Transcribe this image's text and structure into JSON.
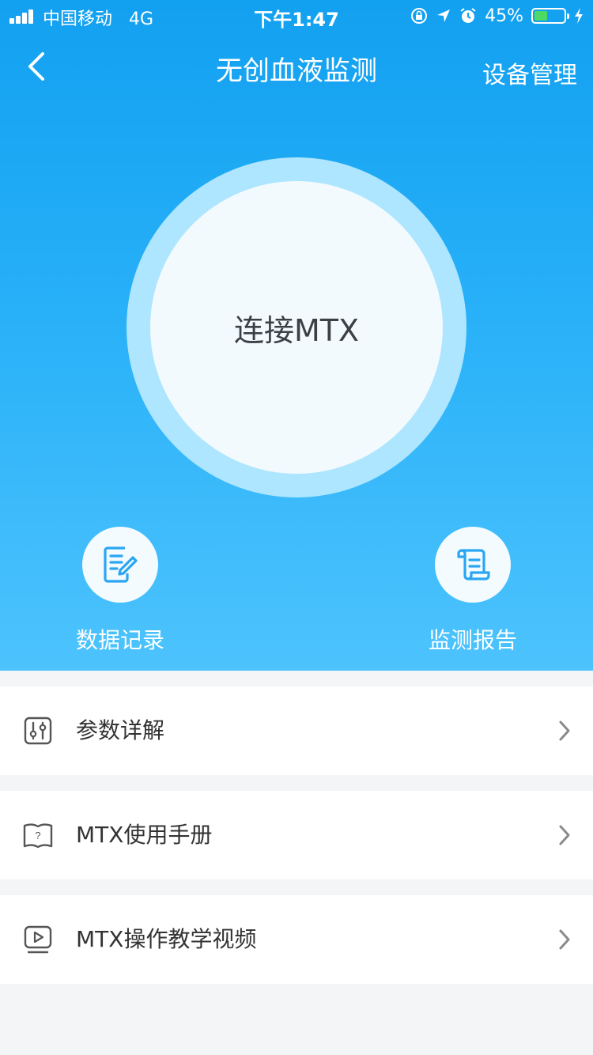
{
  "status_bar": {
    "carrier": "中国移动",
    "network": "4G",
    "time": "下午1:47",
    "battery_percent": "45%",
    "battery_level": 0.45,
    "icons": [
      "lock-rotation-icon",
      "location-arrow-icon",
      "alarm-icon",
      "battery-icon",
      "charging-icon"
    ]
  },
  "nav": {
    "title": "无创血液监测",
    "right_action": "设备管理",
    "back_icon": "chevron-left-icon"
  },
  "connect": {
    "label": "连接MTX"
  },
  "quick_actions": [
    {
      "label": "数据记录",
      "icon": "edit-document-icon"
    },
    {
      "label": "监测报告",
      "icon": "scroll-report-icon"
    }
  ],
  "menu": [
    {
      "label": "参数详解",
      "icon": "sliders-icon"
    },
    {
      "label": "MTX使用手册",
      "icon": "help-book-icon"
    },
    {
      "label": "MTX操作教学视频",
      "icon": "video-play-icon"
    }
  ],
  "colors": {
    "hero_top": "#12a0f0",
    "hero_bottom": "#4dc3fd",
    "accent_icon": "#2aa6f2",
    "ring": "#aee5ff"
  }
}
